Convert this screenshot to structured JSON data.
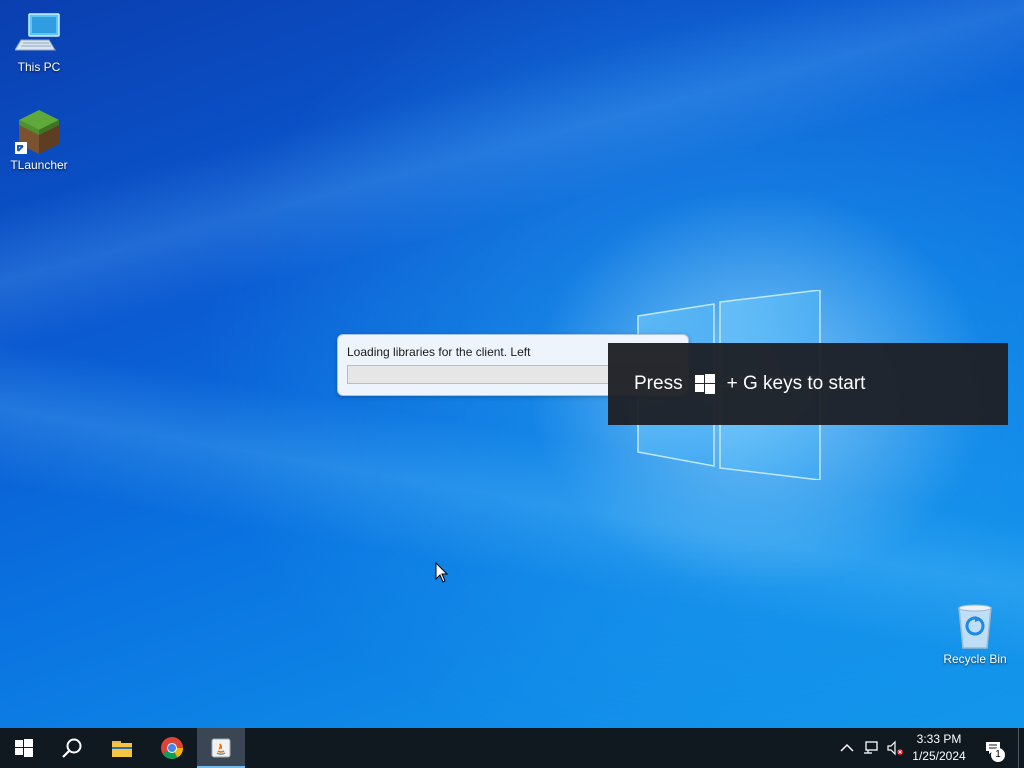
{
  "desktop": {
    "icons": [
      {
        "label": "This PC",
        "icon": "computer-icon"
      },
      {
        "label": "TLauncher",
        "icon": "minecraft-grass-block-icon"
      },
      {
        "label": "Recycle Bin",
        "icon": "recycle-bin-icon"
      }
    ]
  },
  "loading_dialog": {
    "message": "Loading libraries for the client. Left",
    "progress": 0.0
  },
  "toast": {
    "before": "Press",
    "after": "+ G keys to start"
  },
  "taskbar": {
    "apps": [
      {
        "name": "Start",
        "icon": "windows-start-icon"
      },
      {
        "name": "Search",
        "icon": "search-icon"
      },
      {
        "name": "File Explorer",
        "icon": "file-explorer-icon"
      },
      {
        "name": "Google Chrome",
        "icon": "chrome-icon"
      },
      {
        "name": "Java",
        "icon": "java-icon",
        "active": true
      }
    ],
    "tray": {
      "time": "3:33 PM",
      "date": "1/25/2024",
      "notification_count": "1"
    }
  },
  "colors": {
    "taskbar": "#101820",
    "progress_fill": "#06b025",
    "toast_bg": "#1e2026"
  }
}
